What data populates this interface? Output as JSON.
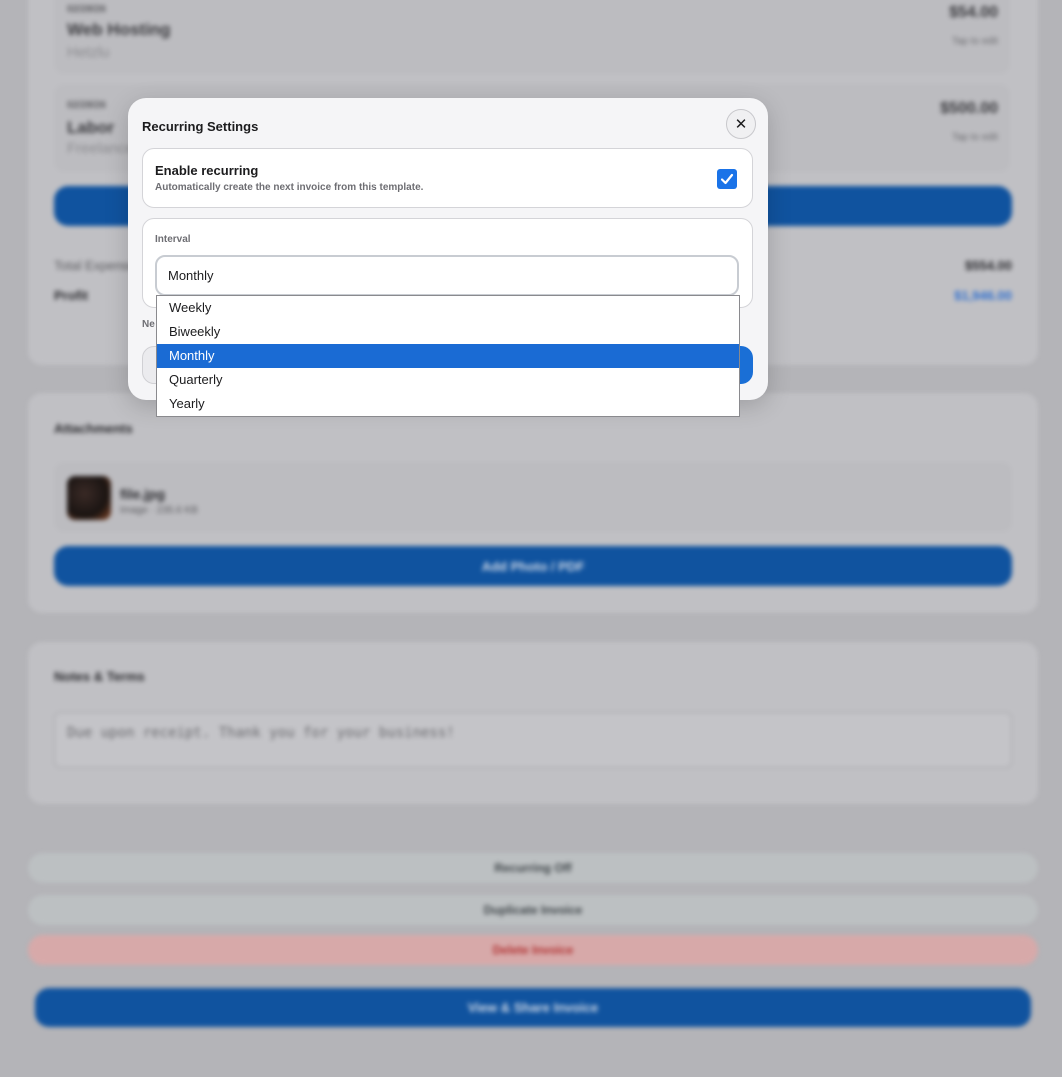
{
  "background": {
    "expenses": [
      {
        "date": "02/28/26",
        "name": "Web Hosting",
        "vendor": "Hetzlu",
        "amount": "$54.00",
        "edit": "Tap to edit"
      },
      {
        "date": "02/28/26",
        "name": "Labor",
        "vendor": "Freelancer",
        "amount": "$500.00",
        "edit": "Tap to edit"
      }
    ],
    "total_expenses_label": "Total Expenses",
    "total_expenses_value": "$554.00",
    "profit_label": "Profit",
    "profit_value": "$1,946.00",
    "attachments_title": "Attachments",
    "attachment_name": "file.jpg",
    "attachment_meta": "Image · 235.6 KB",
    "add_photo_label": "Add Photo / PDF",
    "notes_title": "Notes & Terms",
    "notes_text": "Due upon receipt. Thank you for your business!",
    "recurring_off_label": "Recurring Off",
    "duplicate_label": "Duplicate Invoice",
    "delete_label": "Delete Invoice",
    "view_share_label": "View & Share Invoice"
  },
  "modal": {
    "title": "Recurring Settings",
    "close_glyph": "✕",
    "enable_title": "Enable recurring",
    "enable_desc": "Automatically create the next invoice from this template.",
    "enable_checked": true,
    "interval_label": "Interval",
    "interval_value": "Monthly",
    "next_label": "Ne"
  },
  "dropdown": {
    "options": [
      "Weekly",
      "Biweekly",
      "Monthly",
      "Quarterly",
      "Yearly"
    ],
    "selected": "Monthly"
  },
  "colors": {
    "accent": "#1a73e8",
    "selected_option": "#1a6bd4",
    "danger": "#b03030"
  }
}
